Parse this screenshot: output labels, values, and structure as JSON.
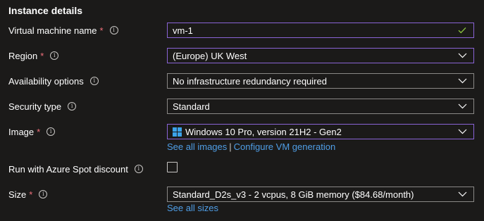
{
  "section": {
    "title": "Instance details"
  },
  "fields": {
    "vm_name": {
      "label": "Virtual machine name",
      "required": "*",
      "value": "vm-1",
      "icon": "checkmark-icon"
    },
    "region": {
      "label": "Region",
      "required": "*",
      "value": "(Europe) UK West",
      "icon": "chevron-down-icon"
    },
    "availability": {
      "label": "Availability options",
      "value": "No infrastructure redundancy required",
      "icon": "chevron-down-icon"
    },
    "security": {
      "label": "Security type",
      "value": "Standard",
      "icon": "chevron-down-icon"
    },
    "image": {
      "label": "Image",
      "required": "*",
      "value": "Windows 10 Pro, version 21H2 - Gen2",
      "icon": "windows-logo-icon",
      "links": {
        "see_all": "See all images",
        "separator": "|",
        "configure": "Configure VM generation"
      }
    },
    "spot": {
      "label": "Run with Azure Spot discount",
      "checked": false
    },
    "size": {
      "label": "Size",
      "required": "*",
      "value": "Standard_D2s_v3 - 2 vcpus, 8 GiB memory ($84.68/month)",
      "icon": "chevron-down-icon",
      "links": {
        "see_all": "See all sizes"
      }
    }
  },
  "info_icon_glyph": "i",
  "colors": {
    "background": "#1b1a19",
    "text": "#ffffff",
    "required": "#f1707b",
    "link": "#4f9ee6",
    "focus_border": "#8a64d6",
    "border": "#8a8886",
    "valid_check": "#8cc63f",
    "windows_blue": "#3ba3ea"
  }
}
